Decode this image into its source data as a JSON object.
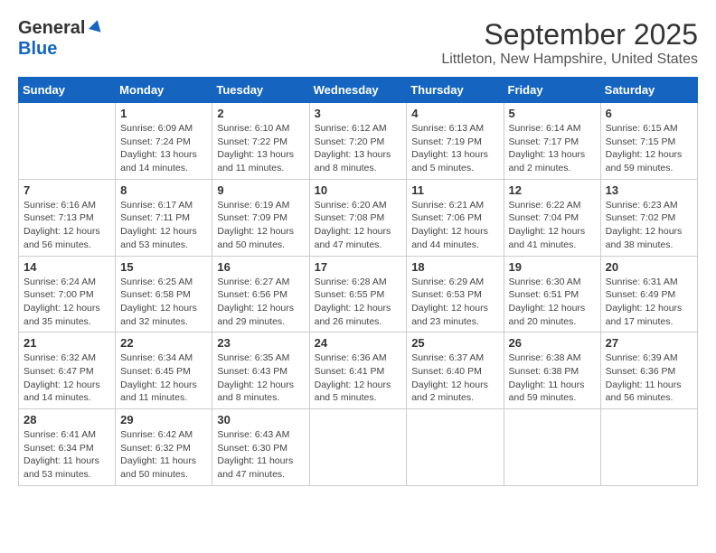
{
  "header": {
    "logo_general": "General",
    "logo_blue": "Blue",
    "month": "September 2025",
    "location": "Littleton, New Hampshire, United States"
  },
  "weekdays": [
    "Sunday",
    "Monday",
    "Tuesday",
    "Wednesday",
    "Thursday",
    "Friday",
    "Saturday"
  ],
  "weeks": [
    [
      {
        "day": "",
        "info": ""
      },
      {
        "day": "1",
        "info": "Sunrise: 6:09 AM\nSunset: 7:24 PM\nDaylight: 13 hours\nand 14 minutes."
      },
      {
        "day": "2",
        "info": "Sunrise: 6:10 AM\nSunset: 7:22 PM\nDaylight: 13 hours\nand 11 minutes."
      },
      {
        "day": "3",
        "info": "Sunrise: 6:12 AM\nSunset: 7:20 PM\nDaylight: 13 hours\nand 8 minutes."
      },
      {
        "day": "4",
        "info": "Sunrise: 6:13 AM\nSunset: 7:19 PM\nDaylight: 13 hours\nand 5 minutes."
      },
      {
        "day": "5",
        "info": "Sunrise: 6:14 AM\nSunset: 7:17 PM\nDaylight: 13 hours\nand 2 minutes."
      },
      {
        "day": "6",
        "info": "Sunrise: 6:15 AM\nSunset: 7:15 PM\nDaylight: 12 hours\nand 59 minutes."
      }
    ],
    [
      {
        "day": "7",
        "info": "Sunrise: 6:16 AM\nSunset: 7:13 PM\nDaylight: 12 hours\nand 56 minutes."
      },
      {
        "day": "8",
        "info": "Sunrise: 6:17 AM\nSunset: 7:11 PM\nDaylight: 12 hours\nand 53 minutes."
      },
      {
        "day": "9",
        "info": "Sunrise: 6:19 AM\nSunset: 7:09 PM\nDaylight: 12 hours\nand 50 minutes."
      },
      {
        "day": "10",
        "info": "Sunrise: 6:20 AM\nSunset: 7:08 PM\nDaylight: 12 hours\nand 47 minutes."
      },
      {
        "day": "11",
        "info": "Sunrise: 6:21 AM\nSunset: 7:06 PM\nDaylight: 12 hours\nand 44 minutes."
      },
      {
        "day": "12",
        "info": "Sunrise: 6:22 AM\nSunset: 7:04 PM\nDaylight: 12 hours\nand 41 minutes."
      },
      {
        "day": "13",
        "info": "Sunrise: 6:23 AM\nSunset: 7:02 PM\nDaylight: 12 hours\nand 38 minutes."
      }
    ],
    [
      {
        "day": "14",
        "info": "Sunrise: 6:24 AM\nSunset: 7:00 PM\nDaylight: 12 hours\nand 35 minutes."
      },
      {
        "day": "15",
        "info": "Sunrise: 6:25 AM\nSunset: 6:58 PM\nDaylight: 12 hours\nand 32 minutes."
      },
      {
        "day": "16",
        "info": "Sunrise: 6:27 AM\nSunset: 6:56 PM\nDaylight: 12 hours\nand 29 minutes."
      },
      {
        "day": "17",
        "info": "Sunrise: 6:28 AM\nSunset: 6:55 PM\nDaylight: 12 hours\nand 26 minutes."
      },
      {
        "day": "18",
        "info": "Sunrise: 6:29 AM\nSunset: 6:53 PM\nDaylight: 12 hours\nand 23 minutes."
      },
      {
        "day": "19",
        "info": "Sunrise: 6:30 AM\nSunset: 6:51 PM\nDaylight: 12 hours\nand 20 minutes."
      },
      {
        "day": "20",
        "info": "Sunrise: 6:31 AM\nSunset: 6:49 PM\nDaylight: 12 hours\nand 17 minutes."
      }
    ],
    [
      {
        "day": "21",
        "info": "Sunrise: 6:32 AM\nSunset: 6:47 PM\nDaylight: 12 hours\nand 14 minutes."
      },
      {
        "day": "22",
        "info": "Sunrise: 6:34 AM\nSunset: 6:45 PM\nDaylight: 12 hours\nand 11 minutes."
      },
      {
        "day": "23",
        "info": "Sunrise: 6:35 AM\nSunset: 6:43 PM\nDaylight: 12 hours\nand 8 minutes."
      },
      {
        "day": "24",
        "info": "Sunrise: 6:36 AM\nSunset: 6:41 PM\nDaylight: 12 hours\nand 5 minutes."
      },
      {
        "day": "25",
        "info": "Sunrise: 6:37 AM\nSunset: 6:40 PM\nDaylight: 12 hours\nand 2 minutes."
      },
      {
        "day": "26",
        "info": "Sunrise: 6:38 AM\nSunset: 6:38 PM\nDaylight: 11 hours\nand 59 minutes."
      },
      {
        "day": "27",
        "info": "Sunrise: 6:39 AM\nSunset: 6:36 PM\nDaylight: 11 hours\nand 56 minutes."
      }
    ],
    [
      {
        "day": "28",
        "info": "Sunrise: 6:41 AM\nSunset: 6:34 PM\nDaylight: 11 hours\nand 53 minutes."
      },
      {
        "day": "29",
        "info": "Sunrise: 6:42 AM\nSunset: 6:32 PM\nDaylight: 11 hours\nand 50 minutes."
      },
      {
        "day": "30",
        "info": "Sunrise: 6:43 AM\nSunset: 6:30 PM\nDaylight: 11 hours\nand 47 minutes."
      },
      {
        "day": "",
        "info": ""
      },
      {
        "day": "",
        "info": ""
      },
      {
        "day": "",
        "info": ""
      },
      {
        "day": "",
        "info": ""
      }
    ]
  ]
}
